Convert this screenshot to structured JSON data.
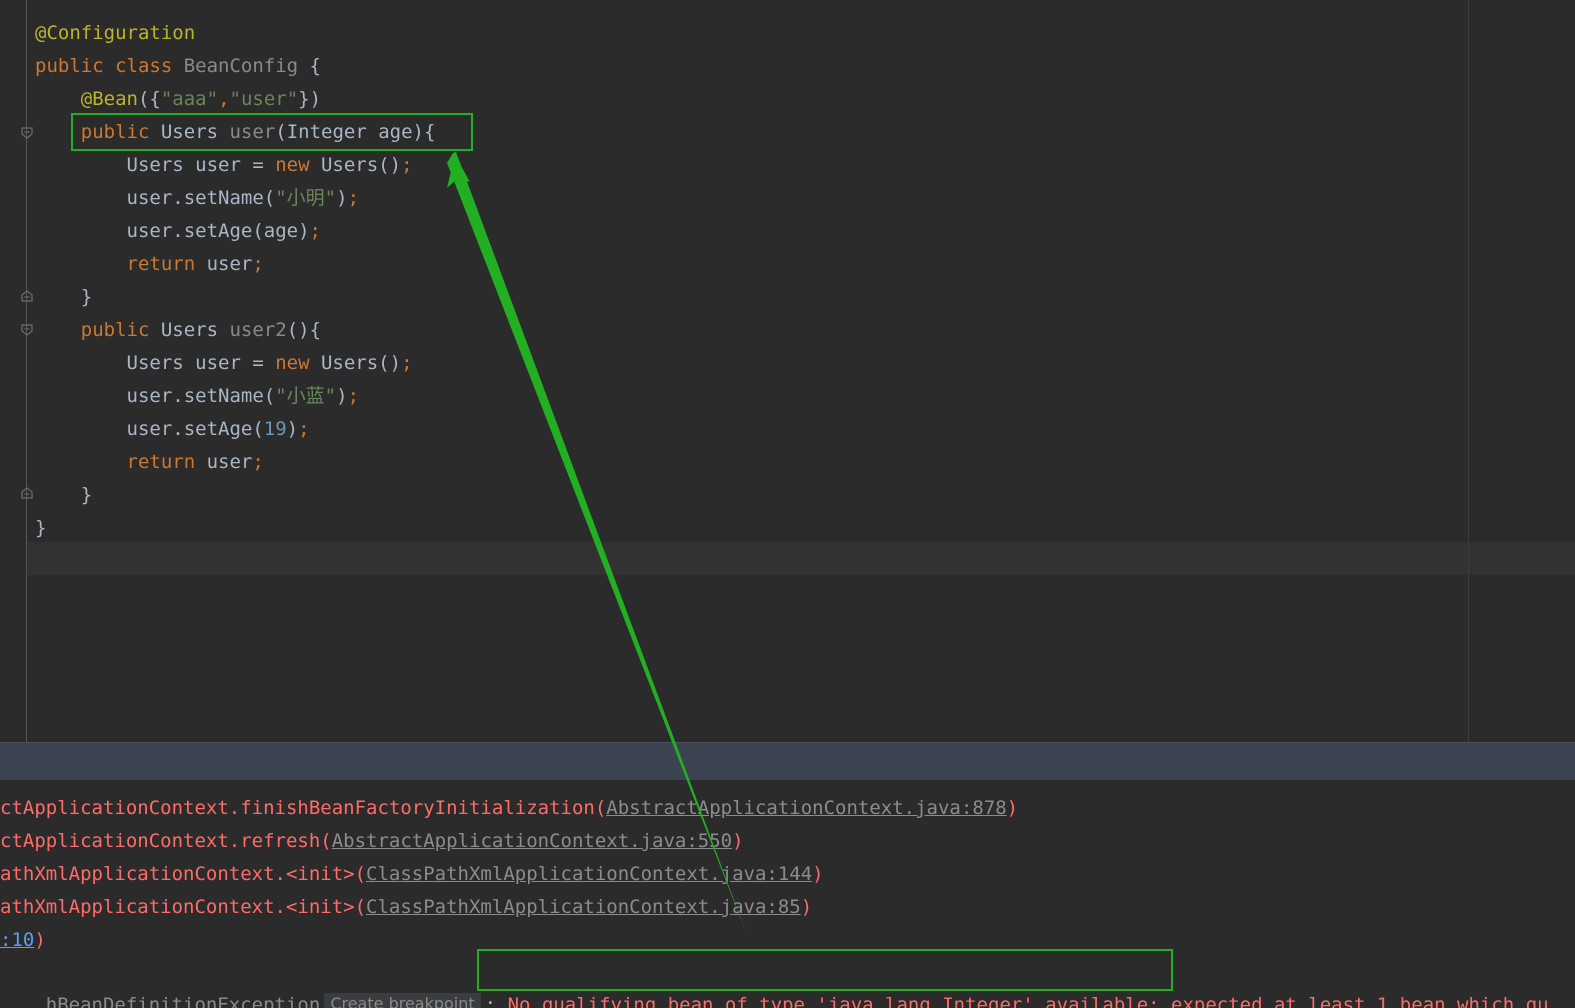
{
  "editor": {
    "lines": [
      {
        "segments": [
          {
            "t": "@Configuration",
            "c": "ann"
          }
        ]
      },
      {
        "segments": [
          {
            "t": "public class ",
            "c": "kw"
          },
          {
            "t": "BeanConfig",
            "c": "gray"
          },
          {
            "t": " {",
            "c": ""
          }
        ]
      },
      {
        "segments": [
          {
            "t": "    ",
            "c": ""
          },
          {
            "t": "@Bean",
            "c": "ann"
          },
          {
            "t": "({",
            "c": ""
          },
          {
            "t": "\"aaa\"",
            "c": "str"
          },
          {
            "t": ",",
            "c": "kw"
          },
          {
            "t": "\"user\"",
            "c": "str"
          },
          {
            "t": "})",
            "c": ""
          }
        ]
      },
      {
        "segments": [
          {
            "t": "    ",
            "c": ""
          },
          {
            "t": "public ",
            "c": "kw"
          },
          {
            "t": "Users ",
            "c": ""
          },
          {
            "t": "user",
            "c": "gray"
          },
          {
            "t": "(Integer age){",
            "c": ""
          }
        ]
      },
      {
        "segments": [
          {
            "t": "        Users user = ",
            "c": ""
          },
          {
            "t": "new ",
            "c": "kw"
          },
          {
            "t": "Users()",
            "c": ""
          },
          {
            "t": ";",
            "c": "kw"
          }
        ]
      },
      {
        "segments": [
          {
            "t": "        user.setName(",
            "c": ""
          },
          {
            "t": "\"小明\"",
            "c": "str"
          },
          {
            "t": ")",
            "c": ""
          },
          {
            "t": ";",
            "c": "kw"
          }
        ]
      },
      {
        "segments": [
          {
            "t": "        user.setAge(age)",
            "c": ""
          },
          {
            "t": ";",
            "c": "kw"
          }
        ]
      },
      {
        "segments": [
          {
            "t": "        ",
            "c": ""
          },
          {
            "t": "return ",
            "c": "kw"
          },
          {
            "t": "user",
            "c": ""
          },
          {
            "t": ";",
            "c": "kw"
          }
        ]
      },
      {
        "segments": [
          {
            "t": "    }",
            "c": ""
          }
        ]
      },
      {
        "segments": [
          {
            "t": "    ",
            "c": ""
          },
          {
            "t": "public ",
            "c": "kw"
          },
          {
            "t": "Users ",
            "c": ""
          },
          {
            "t": "user2",
            "c": "gray"
          },
          {
            "t": "(){",
            "c": ""
          }
        ]
      },
      {
        "segments": [
          {
            "t": "        Users user = ",
            "c": ""
          },
          {
            "t": "new ",
            "c": "kw"
          },
          {
            "t": "Users()",
            "c": ""
          },
          {
            "t": ";",
            "c": "kw"
          }
        ]
      },
      {
        "segments": [
          {
            "t": "        user.setName(",
            "c": ""
          },
          {
            "t": "\"小蓝\"",
            "c": "str"
          },
          {
            "t": ")",
            "c": ""
          },
          {
            "t": ";",
            "c": "kw"
          }
        ]
      },
      {
        "segments": [
          {
            "t": "        user.setAge(",
            "c": ""
          },
          {
            "t": "19",
            "c": "num"
          },
          {
            "t": ")",
            "c": ""
          },
          {
            "t": ";",
            "c": "kw"
          }
        ]
      },
      {
        "segments": [
          {
            "t": "        ",
            "c": ""
          },
          {
            "t": "return ",
            "c": "kw"
          },
          {
            "t": "user",
            "c": ""
          },
          {
            "t": ";",
            "c": "kw"
          }
        ]
      },
      {
        "segments": [
          {
            "t": "    }",
            "c": ""
          }
        ]
      },
      {
        "segments": [
          {
            "t": "}",
            "c": ""
          }
        ]
      }
    ]
  },
  "console": {
    "lines": [
      {
        "segments": [
          {
            "t": "ctApplicationContext.finishBeanFactoryInitialization(",
            "c": ""
          },
          {
            "t": "AbstractApplicationContext.java:878",
            "c": "lnk"
          },
          {
            "t": ")",
            "c": ""
          }
        ]
      },
      {
        "segments": [
          {
            "t": "ctApplicationContext.refresh(",
            "c": ""
          },
          {
            "t": "AbstractApplicationContext.java:550",
            "c": "lnk"
          },
          {
            "t": ")",
            "c": ""
          }
        ]
      },
      {
        "segments": [
          {
            "t": "athXmlApplicationContext.<init>(",
            "c": ""
          },
          {
            "t": "ClassPathXmlApplicationContext.java:144",
            "c": "lnk"
          },
          {
            "t": ")",
            "c": ""
          }
        ]
      },
      {
        "segments": [
          {
            "t": "athXmlApplicationContext.<init>(",
            "c": ""
          },
          {
            "t": "ClassPathXmlApplicationContext.java:85",
            "c": "lnk"
          },
          {
            "t": ")",
            "c": ""
          }
        ]
      },
      {
        "segments": [
          {
            "t": ":10",
            "c": "blue"
          },
          {
            "t": ")",
            "c": ""
          }
        ]
      }
    ],
    "exception_line": {
      "exception_name": "hBeanDefinitionException",
      "breakpoint_label": "Create breakpoint",
      "separator": ": ",
      "message_highlighted": "No qualifying bean of type 'java.lang.Integer' available:",
      "message_rest": " expected at least 1 bean which qu"
    }
  },
  "annotation_color": "#22b022"
}
